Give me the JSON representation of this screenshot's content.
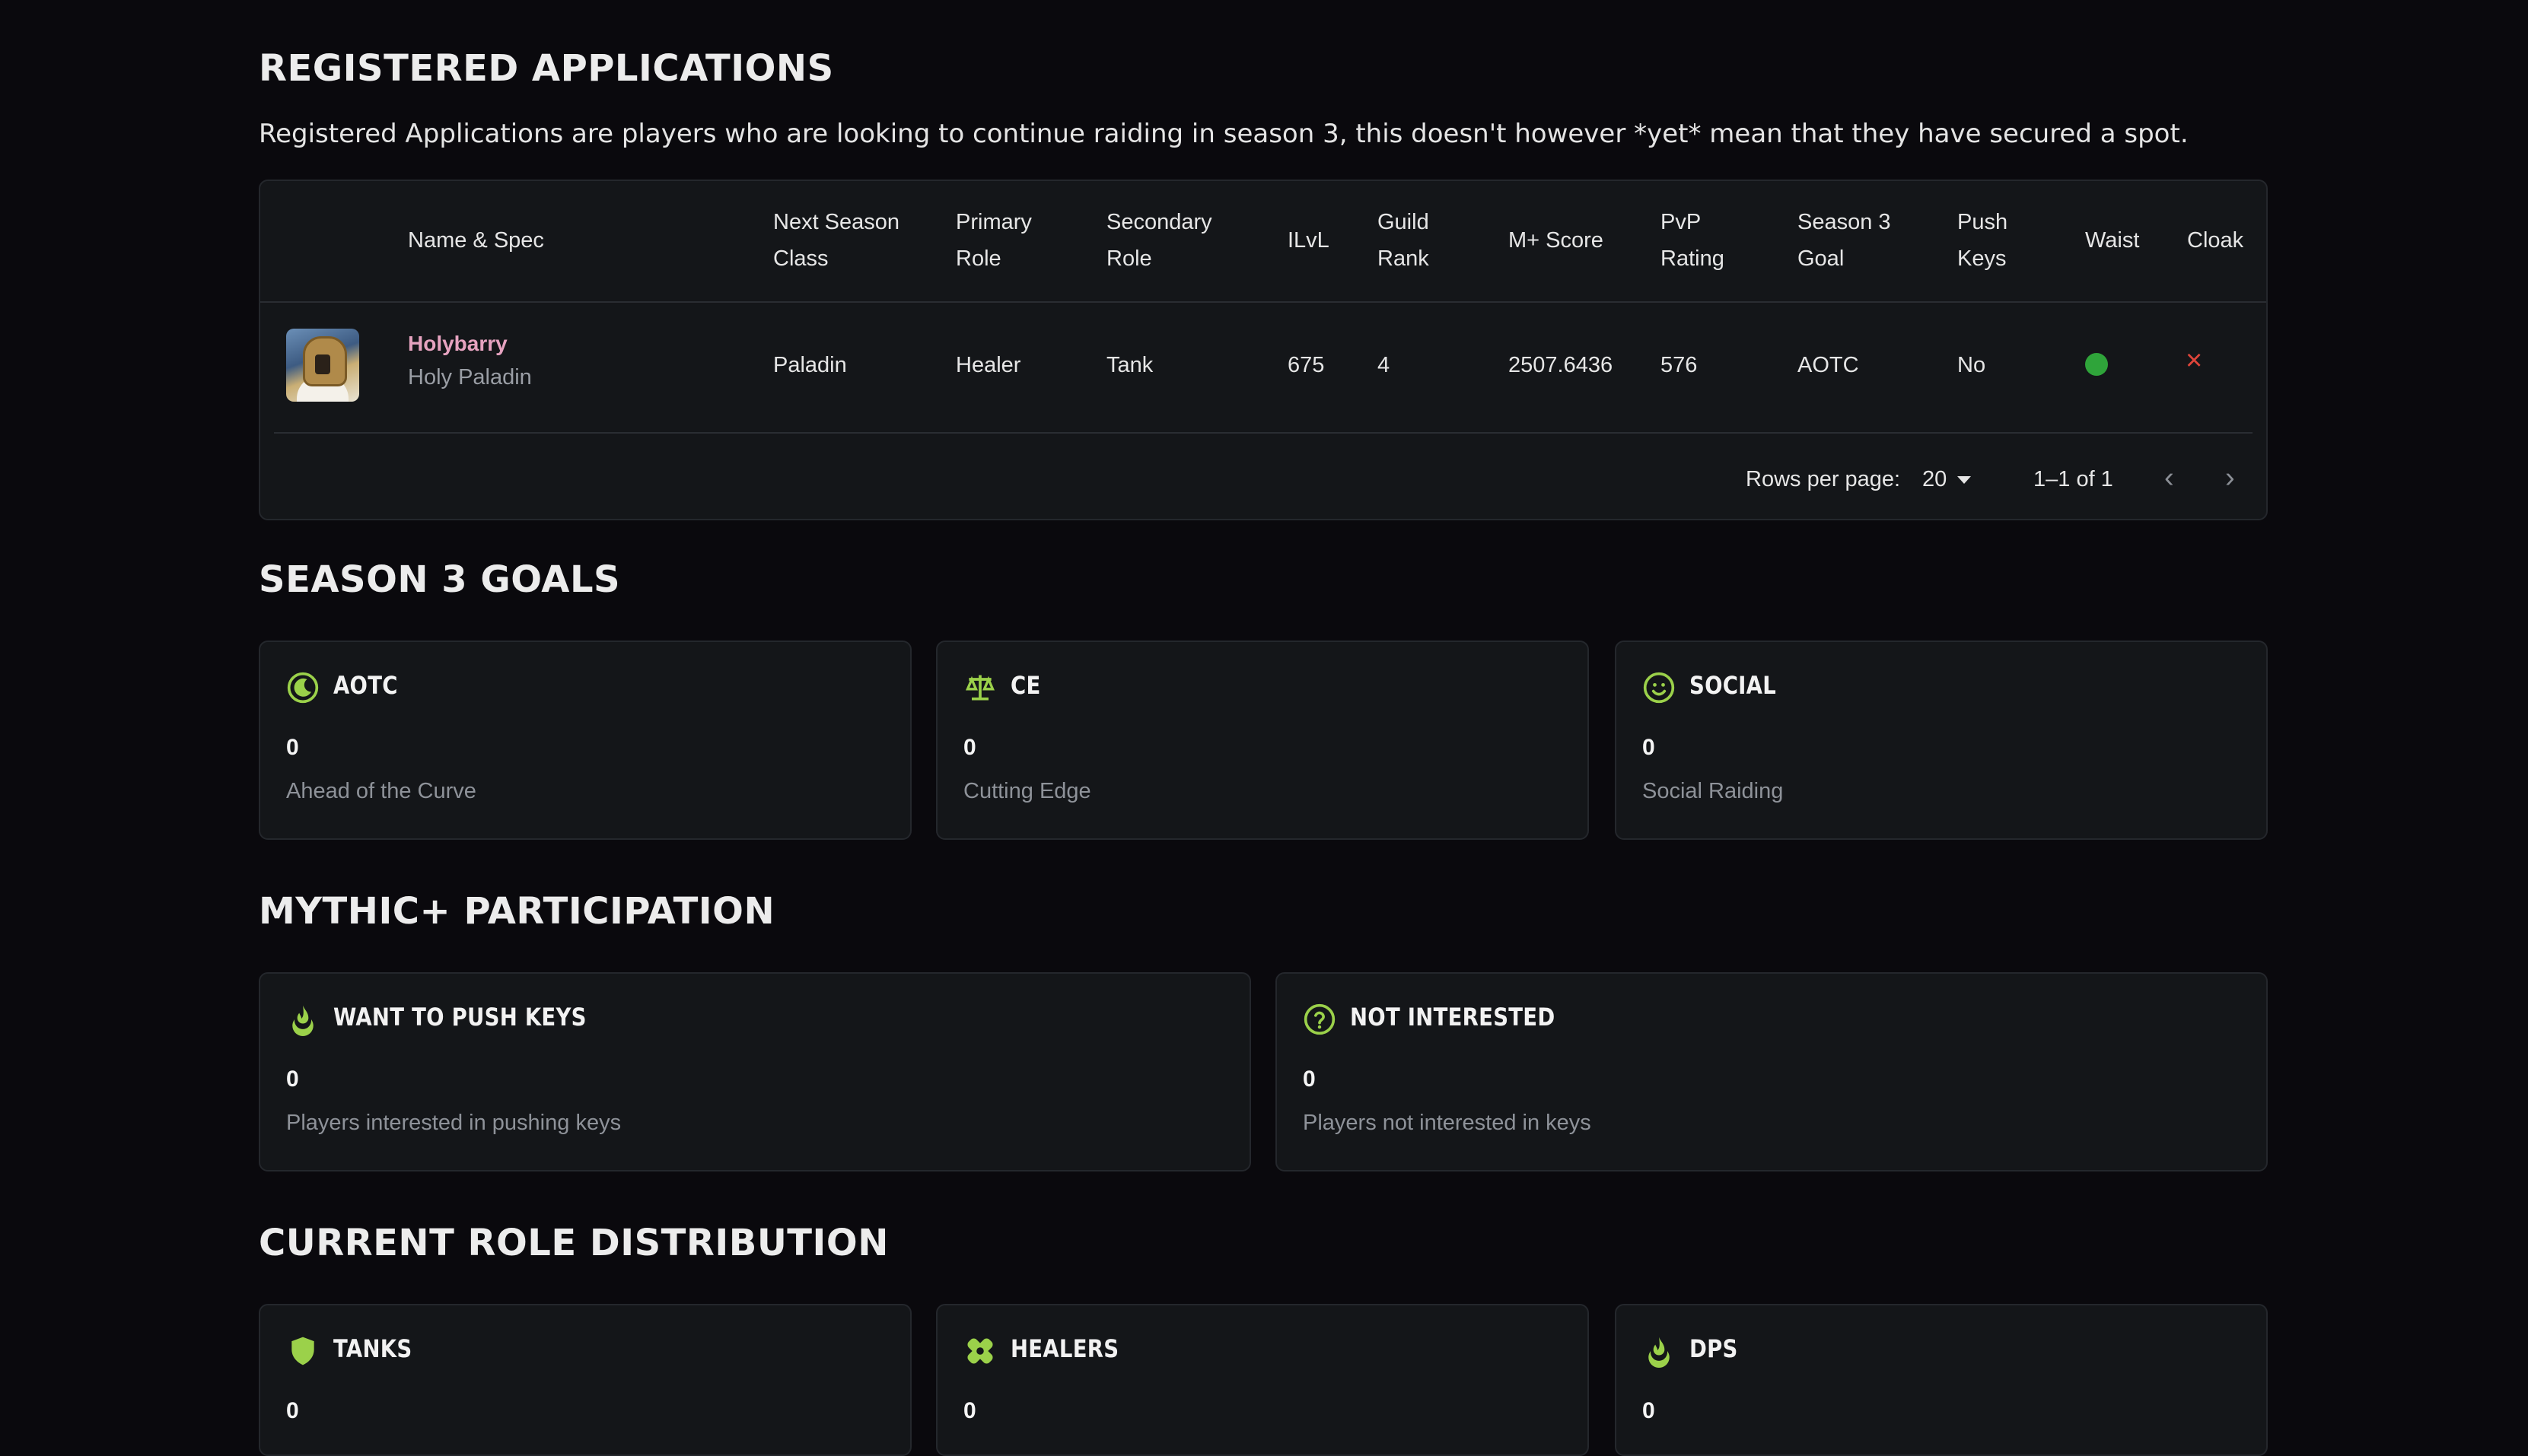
{
  "registered": {
    "title": "REGISTERED APPLICATIONS",
    "intro": "Registered Applications are players who are looking to continue raiding in season 3, this doesn't however *yet* mean that they have secured a spot.",
    "columns": {
      "name_spec": "Name & Spec",
      "next_class_1": "Next Season",
      "next_class_2": "Class",
      "primary_1": "Primary",
      "primary_2": "Role",
      "secondary_1": "Secondary",
      "secondary_2": "Role",
      "ilvl": "ILvL",
      "rank_1": "Guild",
      "rank_2": "Rank",
      "mplus": "M+ Score",
      "pvp_1": "PvP",
      "pvp_2": "Rating",
      "goal_1": "Season 3",
      "goal_2": "Goal",
      "push_1": "Push",
      "push_2": "Keys",
      "waist": "Waist",
      "cloak": "Cloak"
    },
    "rows": [
      {
        "name": "Holybarry",
        "spec": "Holy Paladin",
        "class": "Paladin",
        "primary": "Healer",
        "secondary": "Tank",
        "ilvl": "675",
        "rank": "4",
        "mplus": "2507.6436",
        "pvp": "576",
        "goal": "AOTC",
        "push": "No",
        "waist_status": "green-dot",
        "cloak_status": "×"
      }
    ],
    "pagination": {
      "rows_label": "Rows per page:",
      "rows_value": "20",
      "range": "1–1 of 1"
    }
  },
  "goals": {
    "title": "SEASON 3 GOALS",
    "cards": [
      {
        "icon": "moon-icon",
        "label": "AOTC",
        "value": "0",
        "desc": "Ahead of the Curve"
      },
      {
        "icon": "scales-icon",
        "label": "CE",
        "value": "0",
        "desc": "Cutting Edge"
      },
      {
        "icon": "smile-icon",
        "label": "SOCIAL",
        "value": "0",
        "desc": "Social Raiding"
      }
    ]
  },
  "mythic": {
    "title": "MYTHIC+ PARTICIPATION",
    "cards": [
      {
        "icon": "flame-icon",
        "label": "WANT TO PUSH KEYS",
        "value": "0",
        "desc": "Players interested in pushing keys"
      },
      {
        "icon": "question-icon",
        "label": "NOT INTERESTED",
        "value": "0",
        "desc": "Players not interested in keys"
      }
    ]
  },
  "roles": {
    "title": "CURRENT ROLE DISTRIBUTION",
    "cards": [
      {
        "icon": "shield-icon",
        "label": "TANKS",
        "value": "0"
      },
      {
        "icon": "bandage-icon",
        "label": "HEALERS",
        "value": "0"
      },
      {
        "icon": "flame-icon",
        "label": "DPS",
        "value": "0"
      }
    ]
  },
  "colors": {
    "accent": "#9bd14a",
    "name_pink": "#e6a3c0",
    "status_green": "#2fa43a",
    "status_red": "#e0453a"
  }
}
